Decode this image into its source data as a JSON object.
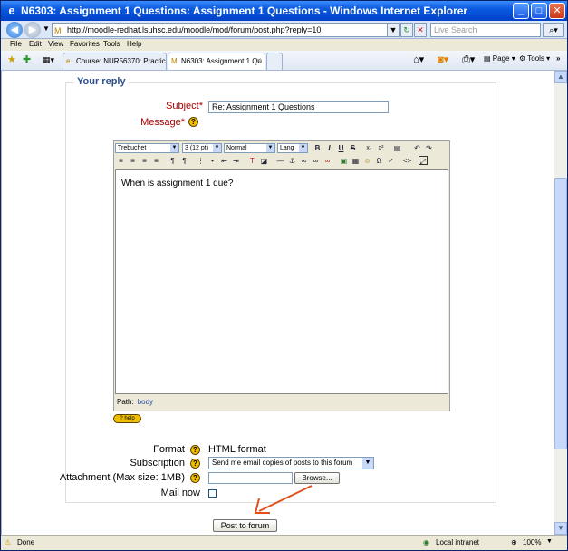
{
  "window": {
    "title": "N6303: Assignment 1 Questions: Assignment 1 Questions - Windows Internet Explorer",
    "controls": {
      "minimize": "_",
      "maximize": "□",
      "close": "✕"
    }
  },
  "addressbar": {
    "url": "http://moodle-redhat.lsuhsc.edu/moodle/mod/forum/post.php?reply=10",
    "search_placeholder": "Live Search"
  },
  "menubar": {
    "items": [
      "File",
      "Edit",
      "View",
      "Favorites",
      "Tools",
      "Help"
    ]
  },
  "tabs": [
    {
      "label": "Course: NUR56370: Practice ...",
      "active": false
    },
    {
      "label": "N6303: Assignment 1 Qu...",
      "active": true
    }
  ],
  "commandbar": {
    "page_label": "Page",
    "tools_label": "Tools"
  },
  "form": {
    "legend": "Your reply",
    "subject_label": "Subject*",
    "subject_value": "Re: Assignment 1 Questions",
    "message_label": "Message*",
    "editor": {
      "font": "Trebuchet",
      "size": "3 (12 pt)",
      "style": "Normal",
      "lang": "Lang",
      "body_text": "When is assignment 1 due?",
      "path_label": "Path:",
      "path_value": "body"
    },
    "help_badge": "? help",
    "format_label": "Format",
    "format_value": "HTML format",
    "subscription_label": "Subscription",
    "subscription_value": "Send me email copies of posts to this forum",
    "attachment_label": "Attachment (Max size: 1MB)",
    "browse_label": "Browse...",
    "mailnow_label": "Mail now",
    "submit_label": "Post to forum"
  },
  "statusbar": {
    "status": "Done",
    "zone": "Local intranet",
    "zoom": "100%"
  },
  "colors": {
    "title_blue": "#0a5ae0",
    "legend_blue": "#2a4f8f",
    "required_red": "#aa0000",
    "arrow_orange": "#e05020"
  }
}
